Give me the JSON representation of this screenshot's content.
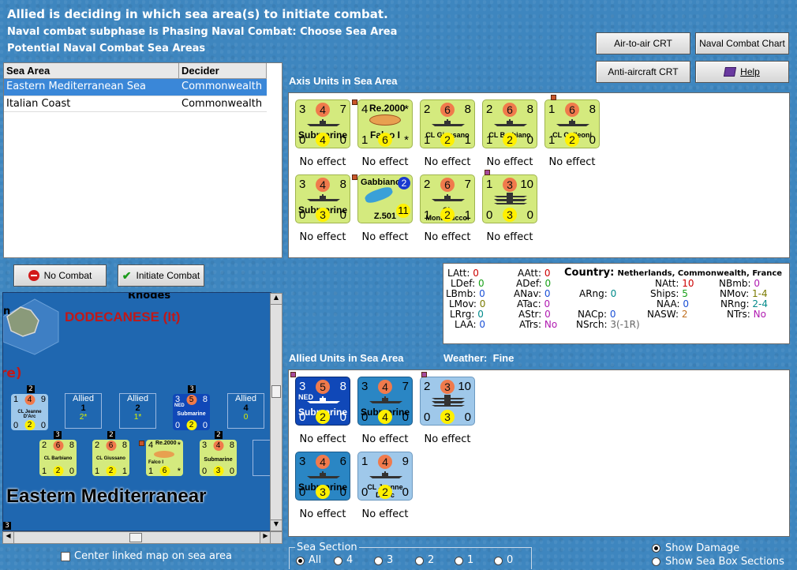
{
  "header": {
    "line1": "Allied is deciding in which sea area(s) to initiate combat.",
    "line2": "Naval combat subphase is Phasing Naval Combat: Choose Sea Area",
    "line3": "Potential Naval Combat Sea Areas"
  },
  "toolbar": {
    "air_to_air": "Air-to-air CRT",
    "naval_chart": "Naval Combat Chart",
    "anti_aircraft": "Anti-aircraft CRT",
    "help": "Help"
  },
  "sea_table": {
    "headers": [
      "Sea Area",
      "Decider"
    ],
    "rows": [
      {
        "area": "Eastern Mediterranean Sea",
        "decider": "Commonwealth"
      },
      {
        "area": "Italian Coast",
        "decider": "Commonwealth"
      }
    ]
  },
  "buttons": {
    "no_combat": "No Combat",
    "initiate_combat": "Initiate Combat"
  },
  "axis": {
    "title": "Axis Units in Sea Area",
    "units": [
      {
        "tl": "3",
        "circle": "4",
        "tr": "7",
        "name": "Submarine",
        "bl": "0",
        "ycircle": "4",
        "br": "0",
        "effect": "No effect"
      },
      {
        "tl": "4",
        "label": "Re.2000",
        "tr": "*",
        "name": "Falco I",
        "bl": "1",
        "ycircle": "6",
        "br": "*",
        "effect": "No effect"
      },
      {
        "tl": "2",
        "circle": "6",
        "tr": "8",
        "name": "CL Giussano",
        "bl": "1",
        "ycircle": "2",
        "br": "1",
        "effect": "No effect"
      },
      {
        "tl": "2",
        "circle": "6",
        "tr": "8",
        "name": "CL Barbiano",
        "bl": "1",
        "ycircle": "2",
        "br": "0",
        "effect": "No effect"
      },
      {
        "tl": "1",
        "circle": "6",
        "tr": "8",
        "name": "CL Colleoni",
        "bl": "1",
        "ycircle": "2",
        "br": "0",
        "effect": "No effect"
      },
      {
        "tl": "3",
        "circle": "4",
        "tr": "8",
        "name": "Submarine",
        "bl": "0",
        "ycircle": "3",
        "br": "0",
        "effect": "No effect"
      },
      {
        "label": "Gabbiano",
        "bcircle": "2",
        "name": "Z.501",
        "ycircle": "11",
        "effect": "No effect"
      },
      {
        "tl": "2",
        "circle": "6",
        "tr": "7",
        "name": "CL Montecuccol",
        "bl": "1",
        "ycircle": "2",
        "br": "1",
        "effect": "No effect"
      },
      {
        "tl": "1",
        "circle": "3",
        "tr": "10",
        "name": "",
        "bl": "0",
        "ycircle": "3",
        "br": "0",
        "effect": "No effect"
      }
    ]
  },
  "info": {
    "latt": "LAtt:",
    "latt_v": "0",
    "ldef": "LDef:",
    "ldef_v": "0",
    "lbmb": "LBmb:",
    "lbmb_v": "0",
    "lmov": "LMov:",
    "lmov_v": "0",
    "lrrg": "LRrg:",
    "lrrg_v": "0",
    "laa": "LAA:",
    "laa_v": "0",
    "aatt": "AAtt:",
    "aatt_v": "0",
    "adef": "ADef:",
    "adef_v": "0",
    "anav": "ANav:",
    "anav_v": "0",
    "atac": "ATac:",
    "atac_v": "0",
    "astr": "AStr:",
    "astr_v": "0",
    "atrs": "ATrs:",
    "atrs_v": "No",
    "country": "Country:",
    "country_v": "Netherlands, Commonwealth, France",
    "arng": "ARng:",
    "arng_v": "0",
    "nacp": "NACp:",
    "nacp_v": "0",
    "nsrch": "NSrch:",
    "nsrch_v": "3(-1R)",
    "natt": "NAtt:",
    "natt_v": "10",
    "ships": "Ships:",
    "ships_v": "5",
    "naa": "NAA:",
    "naa_v": "0",
    "nasw": "NASW:",
    "nasw_v": "2",
    "nbmb": "NBmb:",
    "nbmb_v": "0",
    "nmov": "NMov:",
    "nmov_v": "1-4",
    "nrng": "NRng:",
    "nrng_v": "2-4",
    "ntrs": "NTrs:",
    "ntrs_v": "No"
  },
  "allied": {
    "title": "Allied Units in Sea Area",
    "weather_label": "Weather:",
    "weather_value": "Fine",
    "units": [
      {
        "tl": "3",
        "circle": "5",
        "tr": "8",
        "tag": "NED",
        "name": "Submarine",
        "bl": "0",
        "ycircle": "2",
        "br": "0",
        "effect": "No effect"
      },
      {
        "tl": "3",
        "circle": "4",
        "tr": "7",
        "name": "Submarine",
        "bl": "0",
        "ycircle": "4",
        "br": "0",
        "effect": "No effect"
      },
      {
        "tl": "2",
        "circle": "3",
        "tr": "10",
        "name": "",
        "bl": "0",
        "ycircle": "3",
        "br": "0",
        "effect": "No effect"
      },
      {
        "tl": "3",
        "circle": "4",
        "tr": "6",
        "name": "Submarine",
        "bl": "0",
        "ycircle": "3",
        "br": "0",
        "effect": "No effect"
      },
      {
        "tl": "1",
        "circle": "4",
        "tr": "9",
        "name": "CL Jeanne D'Arc",
        "bl": "0",
        "ycircle": "2",
        "br": "0",
        "effect": "No effect"
      }
    ]
  },
  "map": {
    "region_label": "DODECANESE (It)",
    "rhodes": "Rhodes",
    "sea_label": "Eastern Mediterranear",
    "left_fragment": "re)",
    "left_n": "n",
    "allied_boxes": [
      {
        "label": "Allied",
        "num": "1",
        "sub": "2*"
      },
      {
        "label": "Allied",
        "num": "2",
        "sub": "1*"
      },
      {
        "label": "Allied",
        "num": "4",
        "sub": "0"
      }
    ]
  },
  "footer": {
    "center_map": "Center linked map on sea area",
    "sea_section": "Sea Section",
    "options": [
      "All",
      "4",
      "3",
      "2",
      "1",
      "0"
    ],
    "show_damage": "Show Damage",
    "show_sections": "Show Sea Box Sections"
  },
  "colors": {
    "background": "#3e86bf",
    "axis_counter": "#d4ea7e",
    "selected_row": "#3a87d8"
  }
}
